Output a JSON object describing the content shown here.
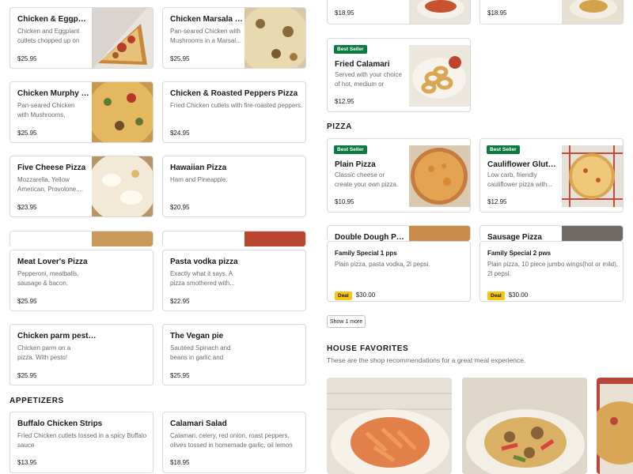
{
  "left_top_items": [
    {
      "name": "Chicken & Eggplant Pizza",
      "desc": "Chicken and Eggplant cutlets chopped up on t...",
      "price": "$25.95"
    },
    {
      "name": "Chicken Marsala Pizza",
      "desc": "Pan-seared Chicken with Mushrooms in a Marsal...",
      "price": "$25.95"
    },
    {
      "name": "Chicken Murphy Pizza",
      "desc": "Pan-seared Chicken with Mushrooms, peppers,...",
      "price": "$25.95"
    },
    {
      "name": "Chicken & Roasted Peppers Pizza",
      "desc": "Fried Chicken cutlets with fire-roasted peppers.",
      "price": "$24.95"
    },
    {
      "name": "Five Cheese Pizza",
      "desc": "Mozzarella, Yellow American, Provolone,...",
      "price": "$23.95"
    },
    {
      "name": "Hawaiian Pizza",
      "desc": "Ham and Pineapple.",
      "price": "$20.95"
    },
    {
      "name": "Meat Lover's Pizza",
      "desc": "Pepperoni, meatballs, sausage & bacon.",
      "price": "$25.95"
    },
    {
      "name": "Pasta vodka pizza",
      "desc": "Exactly what it says. A pizza smothered with...",
      "price": "$22.95"
    },
    {
      "name": "Chicken parm pesto...",
      "desc": "Chicken parm on a pizza. With pesto!",
      "price": "$25.95"
    },
    {
      "name": "The Vegan pie",
      "desc": "Sautéed Spinach and beans in garlic and oil....",
      "price": "$25.95"
    }
  ],
  "appetizers": {
    "title": "APPETIZERS",
    "items": [
      {
        "name": "Buffalo Chicken Strips",
        "desc": "Fried Chicken cutlets tossed in a spicy Buffalo sauce",
        "price": "$13.95"
      },
      {
        "name": "Calamari Salad",
        "desc": "Calamari, celery, red onion, roast peppers, olives tossed in homemade garlic, oil lemon sauce.",
        "price": "$18.95"
      }
    ]
  },
  "right_top_prices": [
    "$18.95",
    "$18.95"
  ],
  "fried_calamari": {
    "badge": "Best Seller",
    "name": "Fried Calamari",
    "desc": "Served with your choice of hot, medium or mild...",
    "price": "$12.95"
  },
  "pizza_section": {
    "title": "PIZZA",
    "items": [
      {
        "badge": "Best Seller",
        "name": "Plain Pizza",
        "desc": "Classic cheese or create your own pizza.",
        "price": "$10.95"
      },
      {
        "badge": "Best Seller",
        "name": "Cauliflower Gluten...",
        "desc": "Low carb, friendly cauliflower pizza with...",
        "price": "$12.95"
      }
    ],
    "partial_names": [
      "Double Dough Pizza",
      "Sausage Pizza"
    ]
  },
  "deals": [
    {
      "name": "Family Special 1 pps",
      "desc": "Plain pizza, pasta vodka, 2l pepsi.",
      "tag": "Deal",
      "price": "$30.00"
    },
    {
      "name": "Family Special 2 pws",
      "desc": "Plain pizza, 10 piece jumbo wings(hot or mild), 2l pepsi.",
      "tag": "Deal",
      "price": "$30.00"
    }
  ],
  "show_more_label": "Show 1 more",
  "house_favorites": {
    "title": "HOUSE FAVORITES",
    "subtitle": "These are the shop recommendations for a great meal experience."
  },
  "colors": {
    "badge_green": "#0b7a3e",
    "deal_yellow": "#f5c518",
    "border": "#d9d9d9"
  }
}
